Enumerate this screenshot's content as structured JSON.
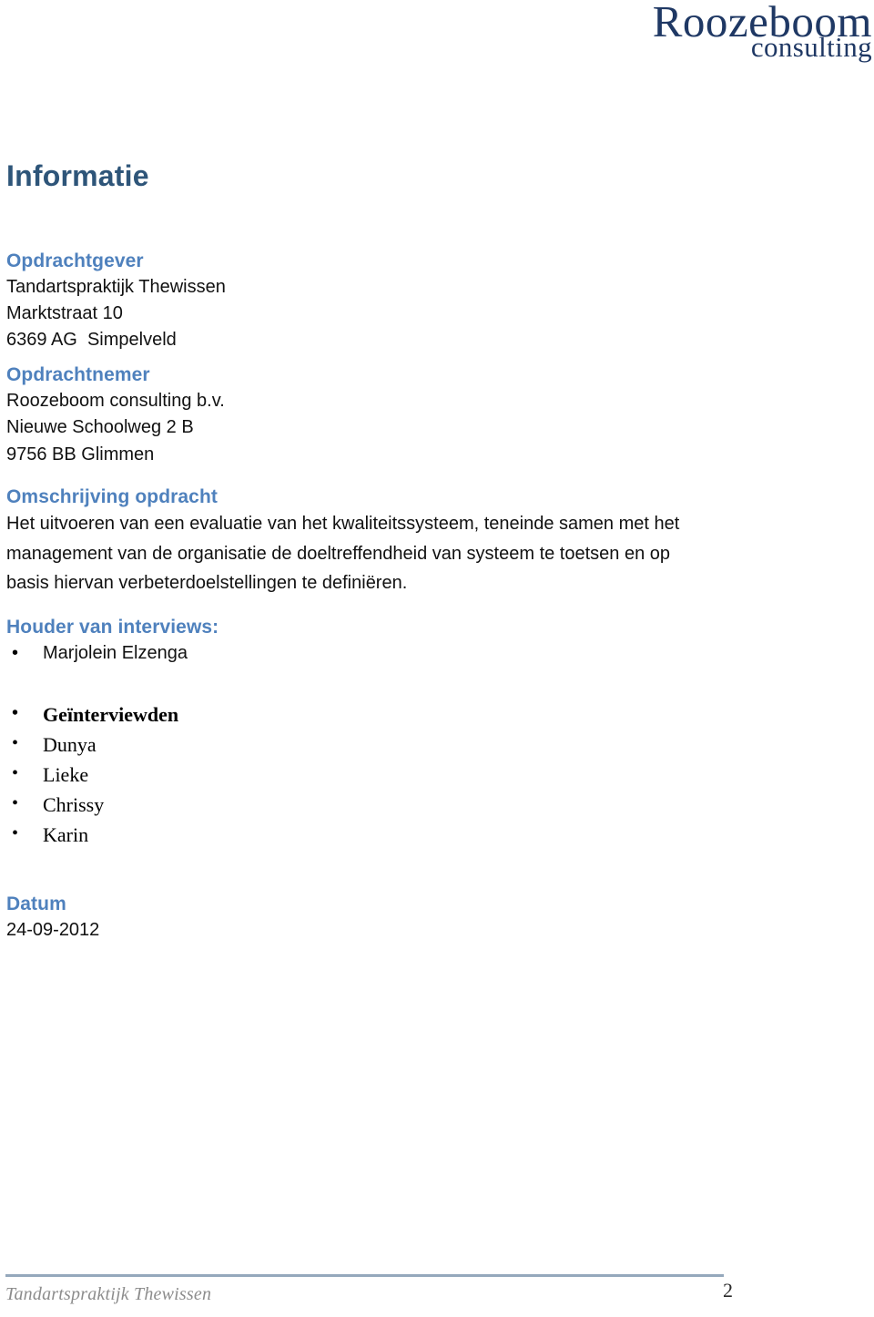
{
  "logo": {
    "main": "Roozeboom",
    "sub": "consulting",
    "color": "#1F3864"
  },
  "document": {
    "title": "Informatie",
    "title_color": "#2E5579",
    "subhead_color": "#4F81BD"
  },
  "sections": {
    "client": {
      "heading": "Opdrachtgever",
      "lines": [
        "Tandartspraktijk Thewissen",
        "Marktstraat 10",
        "6369 AG  Simpelveld"
      ]
    },
    "contractor": {
      "heading": "Opdrachtnemer",
      "lines": [
        "Roozeboom consulting b.v.",
        "Nieuwe Schoolweg 2 B",
        "9756 BB Glimmen"
      ]
    },
    "assignment": {
      "heading": "Omschrijving opdracht",
      "paragraph": "Het uitvoeren van een evaluatie van het kwaliteitssysteem, teneinde samen met het management van de organisatie de doeltreffendheid van systeem te toetsen en op basis hiervan verbeterdoelstellingen te definiëren."
    },
    "interviews": {
      "heading": "Houder van interviews:",
      "interviewer": "Marjolein Elzenga",
      "interviewees_heading": "Geïnterviewden",
      "interviewees": [
        "Dunya",
        "Lieke",
        "Chrissy",
        "Karin"
      ]
    },
    "date": {
      "heading": "Datum",
      "value": "24-09-2012"
    }
  },
  "footer": {
    "left_text": "Tandartspraktijk Thewissen",
    "page_number": "2",
    "rule_color": "#95A8BC"
  },
  "icons": {
    "bullet": "•"
  }
}
